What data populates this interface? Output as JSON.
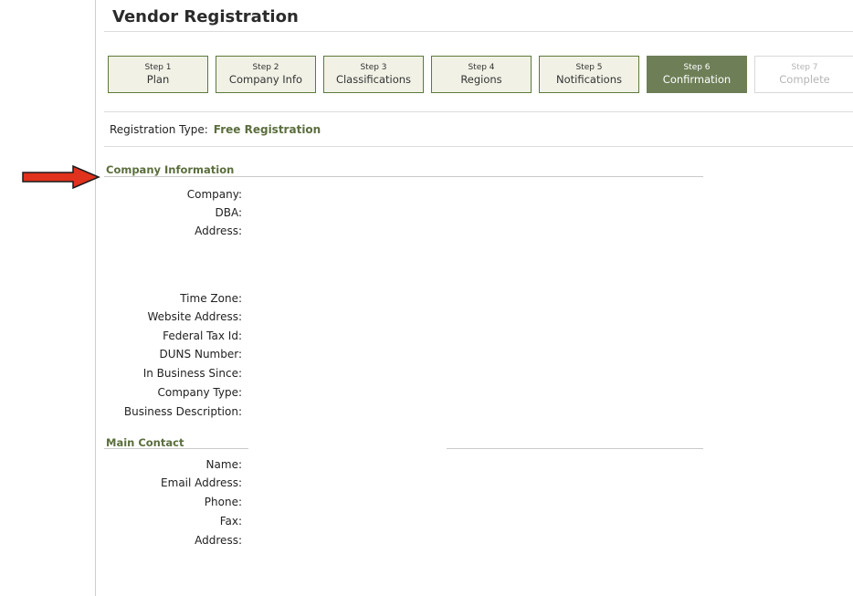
{
  "page_title": "Vendor Registration",
  "steps": [
    {
      "number": "Step 1",
      "label": "Plan",
      "state": "done"
    },
    {
      "number": "Step 2",
      "label": "Company Info",
      "state": "done"
    },
    {
      "number": "Step 3",
      "label": "Classifications",
      "state": "done"
    },
    {
      "number": "Step 4",
      "label": "Regions",
      "state": "done"
    },
    {
      "number": "Step 5",
      "label": "Notifications",
      "state": "done"
    },
    {
      "number": "Step 6",
      "label": "Confirmation",
      "state": "active"
    },
    {
      "number": "Step 7",
      "label": "Complete",
      "state": "disabled"
    }
  ],
  "registration_type": {
    "label": "Registration Type:",
    "value": "Free Registration"
  },
  "company_information": {
    "title": "Company Information",
    "fields": [
      {
        "label": "Company:",
        "value": ""
      },
      {
        "label": "DBA:",
        "value": ""
      },
      {
        "label": "Address:",
        "value": ""
      },
      {
        "label": "Time Zone:",
        "value": ""
      },
      {
        "label": "Website Address:",
        "value": ""
      },
      {
        "label": "Federal Tax Id:",
        "value": ""
      },
      {
        "label": "DUNS Number:",
        "value": ""
      },
      {
        "label": "In Business Since:",
        "value": ""
      },
      {
        "label": "Company Type:",
        "value": ""
      },
      {
        "label": "Business Description:",
        "value": ""
      }
    ]
  },
  "main_contact": {
    "title": "Main Contact",
    "fields": [
      {
        "label": "Name:",
        "value": ""
      },
      {
        "label": "Email Address:",
        "value": ""
      },
      {
        "label": "Phone:",
        "value": ""
      },
      {
        "label": "Fax:",
        "value": ""
      },
      {
        "label": "Address:",
        "value": ""
      }
    ]
  },
  "colors": {
    "accent": "#5b6e3d",
    "active_step": "#6e7f57",
    "step_bg": "#f1f1e6",
    "step_border": "#5c7a3c",
    "arrow": "#e0321c"
  },
  "annotation": {
    "icon": "red-arrow-icon"
  }
}
